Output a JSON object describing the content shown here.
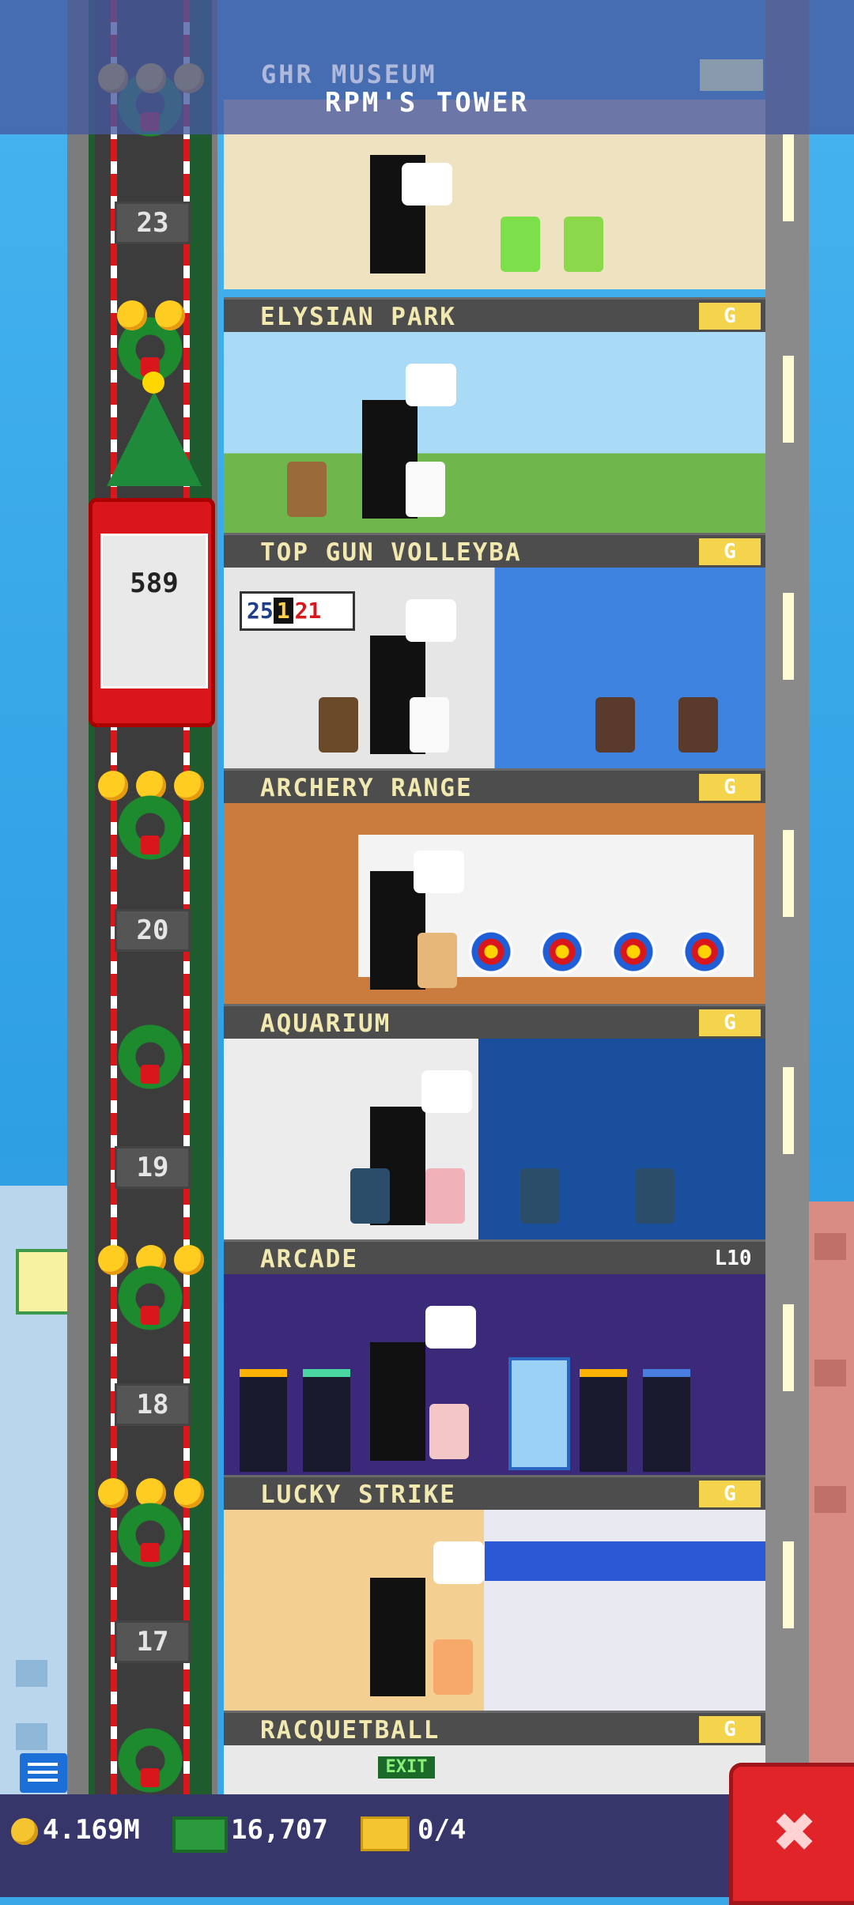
{
  "tower": {
    "name": "RPM'S TOWER",
    "previous_floor_partial": "GHR MUSEUM"
  },
  "elevator": {
    "passenger_count": "589"
  },
  "shaft_floor_numbers": [
    "23",
    "20",
    "19",
    "18",
    "17"
  ],
  "floors": [
    {
      "name": "ELYSIAN PARK",
      "badge": "G",
      "badge_kind": "gold"
    },
    {
      "name": "TOP GUN VOLLEYBA",
      "badge": "G",
      "badge_kind": "gold",
      "scoreboard": {
        "home": "25",
        "period": "1",
        "away": "21"
      }
    },
    {
      "name": "ARCHERY RANGE",
      "badge": "G",
      "badge_kind": "gold"
    },
    {
      "name": "AQUARIUM",
      "badge": "G",
      "badge_kind": "gold"
    },
    {
      "name": "ARCADE",
      "badge": "L10",
      "badge_kind": "level"
    },
    {
      "name": "LUCKY STRIKE",
      "badge": "G",
      "badge_kind": "gold"
    },
    {
      "name": "RACQUETBALL",
      "badge": "G",
      "badge_kind": "gold"
    }
  ],
  "lobby": {
    "exit_sign": "EXIT"
  },
  "stats": {
    "coins": "4.169M",
    "bux": "16,707",
    "tickets": "0/4"
  },
  "colors": {
    "accent_gold": "#f4d44c",
    "close_red": "#e0242a",
    "bottom_bar": "#37366b"
  },
  "icons": {
    "coin": "coin-icon",
    "cash": "cash-icon",
    "ticket": "ticket-icon",
    "close": "close-icon",
    "chat": "chat-icon"
  }
}
